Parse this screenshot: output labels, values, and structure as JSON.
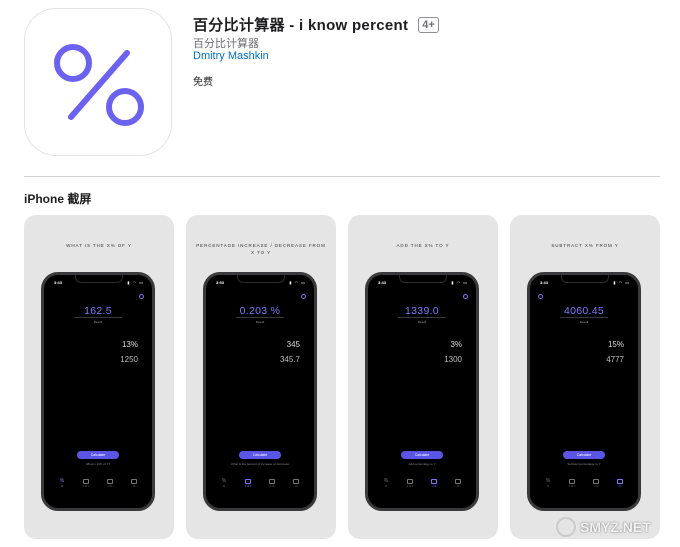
{
  "app": {
    "title": "百分比计算器 - i know percent",
    "age_rating": "4+",
    "subtitle": "百分比计算器",
    "developer": "Dmitry Mashkin",
    "price": "免费",
    "icon_color": "#6b63f0"
  },
  "screenshots_section": {
    "title": "iPhone 截屏"
  },
  "screenshots": [
    {
      "caption": "WHAT IS THE X% OF Y",
      "time": "3:43",
      "status_icons": "▮ ◠ ▭",
      "result": "162.5",
      "result_label": "Result",
      "input_a": "13%",
      "input_b": "1250",
      "button": "Calculate",
      "hint": "What is 13% of Y?",
      "tabs": [
        "%",
        "X of Y",
        "+%",
        "-%"
      ],
      "active_tab": 0
    },
    {
      "caption": "PERCENTAGE INCREASE / DECREASE FROM X TO Y",
      "time": "3:53",
      "status_icons": "▮ ◠ ▭",
      "result": "0.203 %",
      "result_label": "Result",
      "input_a": "345",
      "input_b": "345.7",
      "button": "Calculate",
      "hint": "What is the percent of increase or decrease",
      "tabs": [
        "%",
        "X of Y",
        "+%",
        "-%"
      ],
      "active_tab": 1
    },
    {
      "caption": "ADD THE X% TO Y",
      "time": "3:43",
      "status_icons": "▮ ◠ ▭",
      "result": "1339.0",
      "result_label": "Result",
      "input_a": "3%",
      "input_b": "1300",
      "button": "Calculate",
      "hint": "Add percentage to Y",
      "tabs": [
        "%",
        "X of Y",
        "+%",
        "-%"
      ],
      "active_tab": 2
    },
    {
      "caption": "SUBTRACT X% FROM Y",
      "time": "3:43",
      "status_icons": "▮ ◠ ▭",
      "result": "4060.45",
      "result_label": "Result",
      "input_a": "15%",
      "input_b": "4777",
      "button": "Calculate",
      "hint": "Subtract percentage to Y",
      "tabs": [
        "%",
        "X of Y",
        "+%",
        "-%"
      ],
      "active_tab": 3
    }
  ],
  "watermark": "SMYZ.NET",
  "accent_color": "#5b55e6"
}
